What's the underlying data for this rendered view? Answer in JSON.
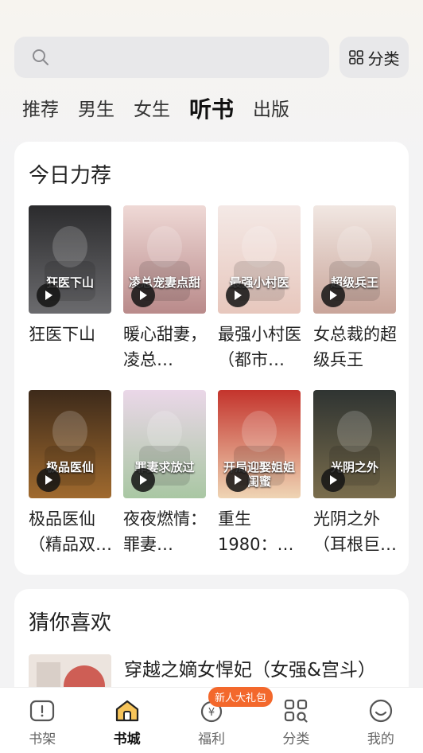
{
  "search": {
    "placeholder": ""
  },
  "category_button": {
    "label": "分类",
    "icon": "grid-icon"
  },
  "tabs": [
    {
      "label": "推荐",
      "active": false
    },
    {
      "label": "男生",
      "active": false
    },
    {
      "label": "女生",
      "active": false
    },
    {
      "label": "听书",
      "active": true
    },
    {
      "label": "出版",
      "active": false
    }
  ],
  "today_picks": {
    "title": "今日力荐",
    "books": [
      {
        "title": "狂医下山",
        "cover_text": "狂医下山",
        "colors": [
          "#2b2b2d",
          "#6b6b6e"
        ]
      },
      {
        "title": "暖心甜妻，凌总…",
        "cover_text": "凌总宠妻点甜",
        "colors": [
          "#efd9d6",
          "#b98a8a"
        ]
      },
      {
        "title": "最强小村医（都市…",
        "cover_text": "最强小村医",
        "colors": [
          "#f4e9e6",
          "#e7c7bd"
        ]
      },
      {
        "title": "女总裁的超级兵王",
        "cover_text": "超级兵王",
        "colors": [
          "#f1e7e2",
          "#c9a59a"
        ]
      },
      {
        "title": "极品医仙（精品双…",
        "cover_text": "极品医仙",
        "colors": [
          "#3d2a1a",
          "#a06a2e"
        ]
      },
      {
        "title": "夜夜燃情：罪妻…",
        "cover_text": "罪妻求放过",
        "colors": [
          "#ead7e8",
          "#a9c7a3"
        ]
      },
      {
        "title": "重生1980：…",
        "cover_text": "开局迎娶姐姐闺蜜",
        "colors": [
          "#c4342c",
          "#efd5b4"
        ]
      },
      {
        "title": "光阴之外（耳根巨…",
        "cover_text": "光阴之外",
        "colors": [
          "#2f3432",
          "#7a6d4c"
        ]
      }
    ]
  },
  "guess": {
    "title": "猜你喜欢",
    "book_title": "穿越之嫡女悍妃（女强&宫斗）"
  },
  "bottom_nav": {
    "badge": "新人大礼包",
    "items": [
      {
        "label": "书架",
        "icon": "bookshelf-icon",
        "active": false
      },
      {
        "label": "书城",
        "icon": "bookstore-icon",
        "active": true
      },
      {
        "label": "福利",
        "icon": "welfare-icon",
        "active": false
      },
      {
        "label": "分类",
        "icon": "category-icon",
        "active": false
      },
      {
        "label": "我的",
        "icon": "profile-icon",
        "active": false
      }
    ]
  }
}
